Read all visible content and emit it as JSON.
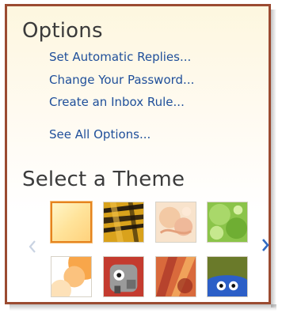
{
  "options": {
    "title": "Options",
    "links": [
      "Set Automatic Replies...",
      "Change Your Password...",
      "Create an Inbox Rule...",
      "See All Options..."
    ]
  },
  "themes": {
    "title": "Select a Theme",
    "tiles": [
      {
        "name": "sunset-orange",
        "selected": true
      },
      {
        "name": "tiger-stripes",
        "selected": false
      },
      {
        "name": "peach-floral",
        "selected": false
      },
      {
        "name": "green-leaves",
        "selected": false
      },
      {
        "name": "orange-bubbles",
        "selected": false
      },
      {
        "name": "robot-cartoon",
        "selected": false
      },
      {
        "name": "autumn-leaves",
        "selected": false
      },
      {
        "name": "blue-monster",
        "selected": false
      }
    ],
    "prev_icon": "chevron-left-icon",
    "next_icon": "chevron-right-icon"
  },
  "colors": {
    "border": "#9b4b31",
    "link": "#1f4f9a",
    "selected_tile": "#e5831f"
  }
}
